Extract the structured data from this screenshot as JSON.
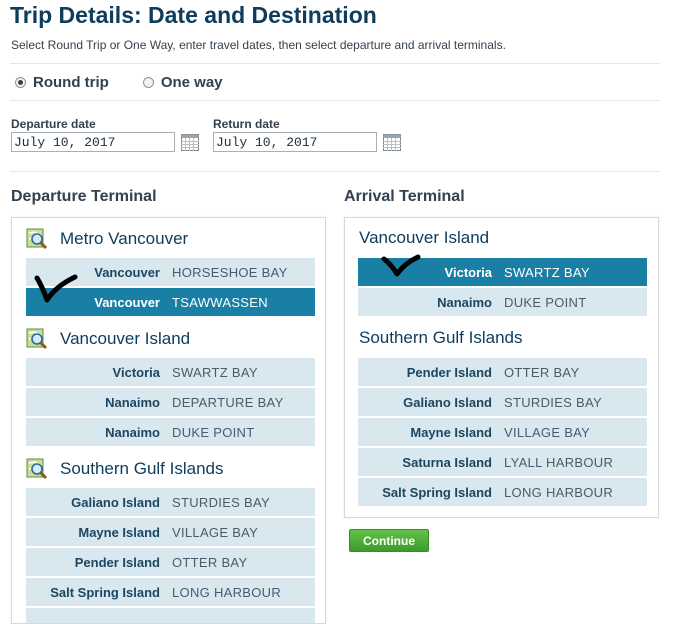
{
  "page": {
    "title": "Trip Details: Date and Destination",
    "subtitle": "Select Round Trip or One Way, enter travel dates, then select departure and arrival terminals."
  },
  "trip_type": {
    "round_trip_label": "Round trip",
    "one_way_label": "One way",
    "selected": "round_trip"
  },
  "dates": {
    "departure_label": "Departure date",
    "departure_value": "July 10, 2017",
    "return_label": "Return date",
    "return_value": "July 10, 2017"
  },
  "departure": {
    "title": "Departure Terminal",
    "groups": [
      {
        "name": "Metro Vancouver",
        "rows": [
          {
            "city": "Vancouver",
            "terminal": "HORSESHOE BAY",
            "selected": false
          },
          {
            "city": "Vancouver",
            "terminal": "TSAWWASSEN",
            "selected": true
          }
        ]
      },
      {
        "name": "Vancouver Island",
        "rows": [
          {
            "city": "Victoria",
            "terminal": "SWARTZ BAY",
            "selected": false
          },
          {
            "city": "Nanaimo",
            "terminal": "DEPARTURE BAY",
            "selected": false
          },
          {
            "city": "Nanaimo",
            "terminal": "DUKE POINT",
            "selected": false
          }
        ]
      },
      {
        "name": "Southern Gulf Islands",
        "rows": [
          {
            "city": "Galiano Island",
            "terminal": "STURDIES BAY",
            "selected": false
          },
          {
            "city": "Mayne Island",
            "terminal": "VILLAGE BAY",
            "selected": false
          },
          {
            "city": "Pender Island",
            "terminal": "OTTER BAY",
            "selected": false
          },
          {
            "city": "Salt Spring Island",
            "terminal": "LONG HARBOUR",
            "selected": false
          }
        ]
      }
    ]
  },
  "arrival": {
    "title": "Arrival Terminal",
    "groups": [
      {
        "name": "Vancouver Island",
        "rows": [
          {
            "city": "Victoria",
            "terminal": "SWARTZ BAY",
            "selected": true
          },
          {
            "city": "Nanaimo",
            "terminal": "DUKE POINT",
            "selected": false
          }
        ]
      },
      {
        "name": "Southern Gulf Islands",
        "rows": [
          {
            "city": "Pender Island",
            "terminal": "OTTER BAY",
            "selected": false
          },
          {
            "city": "Galiano Island",
            "terminal": "STURDIES BAY",
            "selected": false
          },
          {
            "city": "Mayne Island",
            "terminal": "VILLAGE BAY",
            "selected": false
          },
          {
            "city": "Saturna Island",
            "terminal": "LYALL HARBOUR",
            "selected": false
          },
          {
            "city": "Salt Spring Island",
            "terminal": "LONG HARBOUR",
            "selected": false
          }
        ]
      }
    ]
  },
  "continue_label": "Continue",
  "colors": {
    "heading": "#0d3c5c",
    "row_bg": "#d9e7ee",
    "row_selected": "#1a7fa4",
    "continue_button": "#4caf37",
    "check_mark": "#000000"
  },
  "icons": {
    "calendar": "calendar-icon",
    "map": "map-search-icon",
    "check": "check-mark-icon"
  }
}
